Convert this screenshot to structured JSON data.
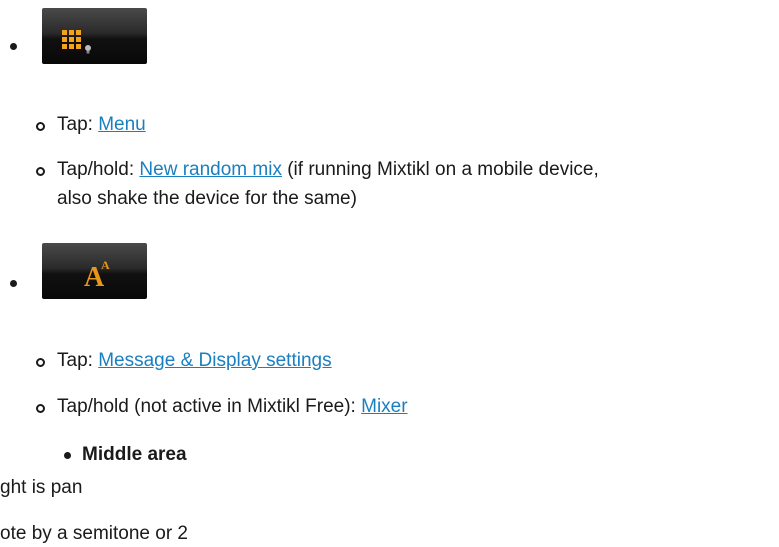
{
  "icons": {
    "grid_icon": "grid-bulb-icon",
    "font_icon": "font-size-icon",
    "grid_color": "#f5a21c",
    "font_color": "#e8961a",
    "font_letter": "A",
    "font_superscript": "A"
  },
  "section1": {
    "item1_prefix": "Tap: ",
    "item1_link": "Menu",
    "item2_prefix": "Tap/hold: ",
    "item2_link": "New random mix",
    "item2_suffix": " (if running Mixtikl on a mobile device,",
    "item2_line2": "also shake the device for the same)"
  },
  "section2": {
    "item1_prefix": "Tap: ",
    "item1_link": "Message & Display settings",
    "item2_prefix": "Tap/hold (not active in Mixtikl Free): ",
    "item2_link": "Mixer"
  },
  "heading": "Middle area",
  "fragments": {
    "line1": "ght is pan",
    "line2": "ote by a semitone or 2"
  },
  "colors": {
    "link": "#1a7fc1",
    "text": "#1a1a1a"
  }
}
